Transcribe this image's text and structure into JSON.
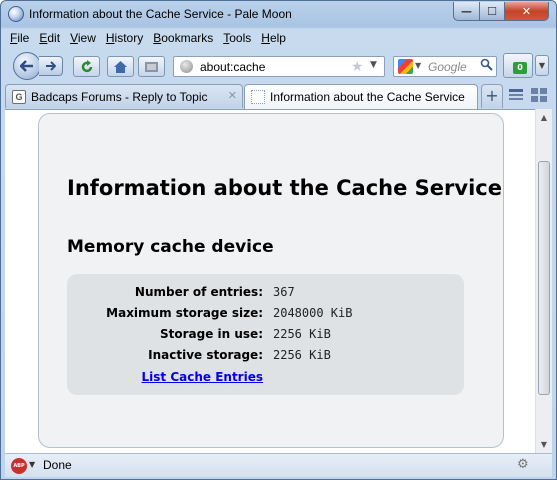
{
  "window": {
    "title": "Information about the Cache Service - Pale Moon",
    "controls": {
      "minimize": "—",
      "maximize": "☐",
      "close": "✕"
    }
  },
  "menu": [
    "File",
    "Edit",
    "View",
    "History",
    "Bookmarks",
    "Tools",
    "Help"
  ],
  "menu_access_keys": [
    "F",
    "E",
    "V",
    "H",
    "B",
    "T",
    "H"
  ],
  "nav": {
    "back_icon": "back-arrow-icon",
    "forward_icon": "forward-arrow-icon",
    "reload_icon": "reload-icon",
    "home_icon": "home-icon",
    "url": "about:cache",
    "search_placeholder": "Google"
  },
  "extension": {
    "badge": "0"
  },
  "tabs": [
    {
      "label": "Badcaps Forums - Reply to Topic",
      "active": false
    },
    {
      "label": "Information about the Cache Service",
      "active": true
    }
  ],
  "page": {
    "title": "Information about the Cache Service",
    "section": "Memory cache device",
    "rows": [
      {
        "label": "Number of entries:",
        "value": "367"
      },
      {
        "label": "Maximum storage size:",
        "value": "2048000 KiB"
      },
      {
        "label": "Storage in use:",
        "value": "2256 KiB"
      },
      {
        "label": "Inactive storage:",
        "value": "2256 KiB"
      }
    ],
    "link": "List Cache Entries"
  },
  "status": {
    "text": "Done",
    "adblock_label": "ABP"
  },
  "colors": {
    "link": "#0000ee",
    "card_bg": "#f0f2f4",
    "info_bg": "#dfe2e5",
    "close_button": "#c4442a"
  }
}
